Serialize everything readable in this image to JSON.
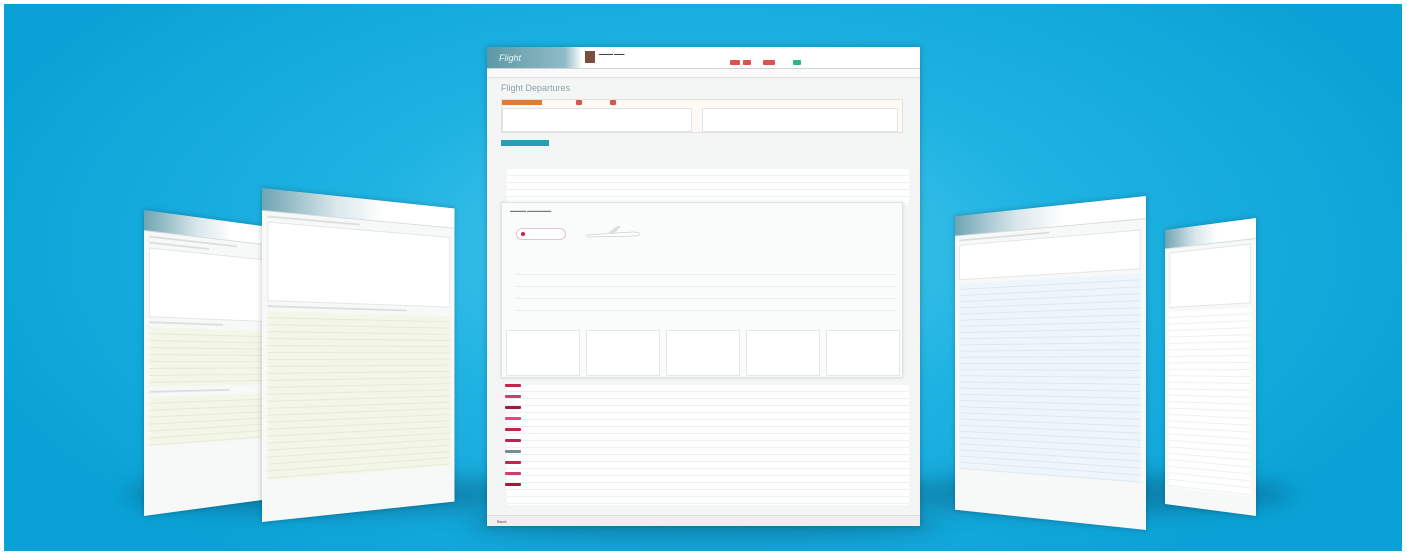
{
  "center_window": {
    "logo": "Flight",
    "title": "Flight Departures",
    "footer_button": "Back",
    "airline_colors": [
      "#c8244a",
      "#d63b6e",
      "#a11c3a",
      "#e04b7a",
      "#c8244a",
      "#b0294e",
      "#7b8a8f",
      "#c8244a",
      "#d63b6e",
      "#a11c3a"
    ]
  },
  "colors": {
    "accent": "#2a9db2",
    "orange": "#e07a35",
    "alert": "#d9534f",
    "ok": "#2fb38d",
    "background": "#1fb3e2"
  }
}
